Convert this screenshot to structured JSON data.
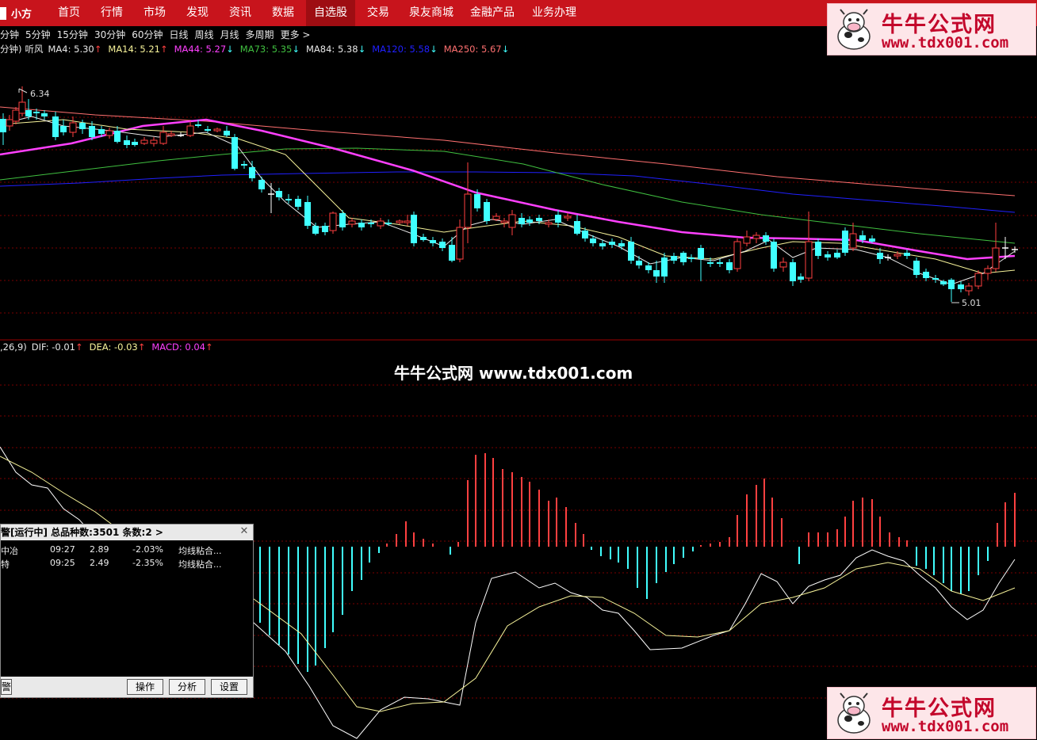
{
  "nav": {
    "logo": "小方",
    "items": [
      "首页",
      "行情",
      "市场",
      "发现",
      "资讯",
      "数据",
      "自选股",
      "交易",
      "泉友商城",
      "金融产品",
      "业务办理"
    ],
    "active": "自选股"
  },
  "periods": [
    "分钟",
    "5分钟",
    "15分钟",
    "30分钟",
    "60分钟",
    "日线",
    "周线",
    "月线",
    "多周期",
    "更多 >"
  ],
  "ma_legend": {
    "prefix": "分钟)",
    "indicator": "听风",
    "items": [
      {
        "label": "MA4: 5.30",
        "arrow": "↑",
        "color": "#e8e8e8",
        "arrow_color": "#ff4040"
      },
      {
        "label": "MA14: 5.21",
        "arrow": "↑",
        "color": "#f7f39a",
        "arrow_color": "#ff4040"
      },
      {
        "label": "MA44: 5.27",
        "arrow": "↓",
        "color": "#ff40ff",
        "arrow_color": "#40ffff"
      },
      {
        "label": "MA73: 5.35",
        "arrow": "↓",
        "color": "#40c040",
        "arrow_color": "#40ffff"
      },
      {
        "label": "MA84: 5.38",
        "arrow": "↓",
        "color": "#e8e8e8",
        "arrow_color": "#40ffff"
      },
      {
        "label": "MA120: 5.58",
        "arrow": "↓",
        "color": "#2020ff",
        "arrow_color": "#40ffff"
      },
      {
        "label": "MA250: 5.67",
        "arrow": "↓",
        "color": "#ff7070",
        "arrow_color": "#40ffff"
      }
    ]
  },
  "price_labels": {
    "high": "6.34",
    "low": "5.01"
  },
  "macd_legend": {
    "params": ",26,9)",
    "items": [
      {
        "label": "DIF: -0.01",
        "arrow": "↑",
        "color": "#e8e8e8"
      },
      {
        "label": "DEA: -0.03",
        "arrow": "↑",
        "color": "#f7f39a"
      },
      {
        "label": "MACD: 0.04",
        "arrow": "↑",
        "color": "#ff40ff"
      }
    ]
  },
  "watermark": {
    "line1": "牛牛公式网",
    "line2": "www.tdx001.com",
    "center": "牛牛公式网 www.tdx001.com"
  },
  "alert_panel": {
    "header": "警[运行中] 总品种数:3501 条数:2  >",
    "rows": [
      {
        "name": "中冶",
        "time": "09:27",
        "price": "2.89",
        "change": "-2.03%",
        "signal": "均线粘合..."
      },
      {
        "name": "特",
        "time": "09:25",
        "price": "2.49",
        "change": "-2.35%",
        "signal": "均线粘合..."
      }
    ],
    "left_button": "警",
    "buttons": [
      "操作",
      "分析",
      "设置"
    ]
  },
  "colors": {
    "up": "#ff4040",
    "down": "#40ffff",
    "ma44": "#ff40ff",
    "ma73": "#40c040",
    "ma120": "#2020ff",
    "ma250": "#ff7070",
    "ma14": "#f7f39a",
    "ma4": "#e8e8e8",
    "grid": "#7a0000"
  }
}
